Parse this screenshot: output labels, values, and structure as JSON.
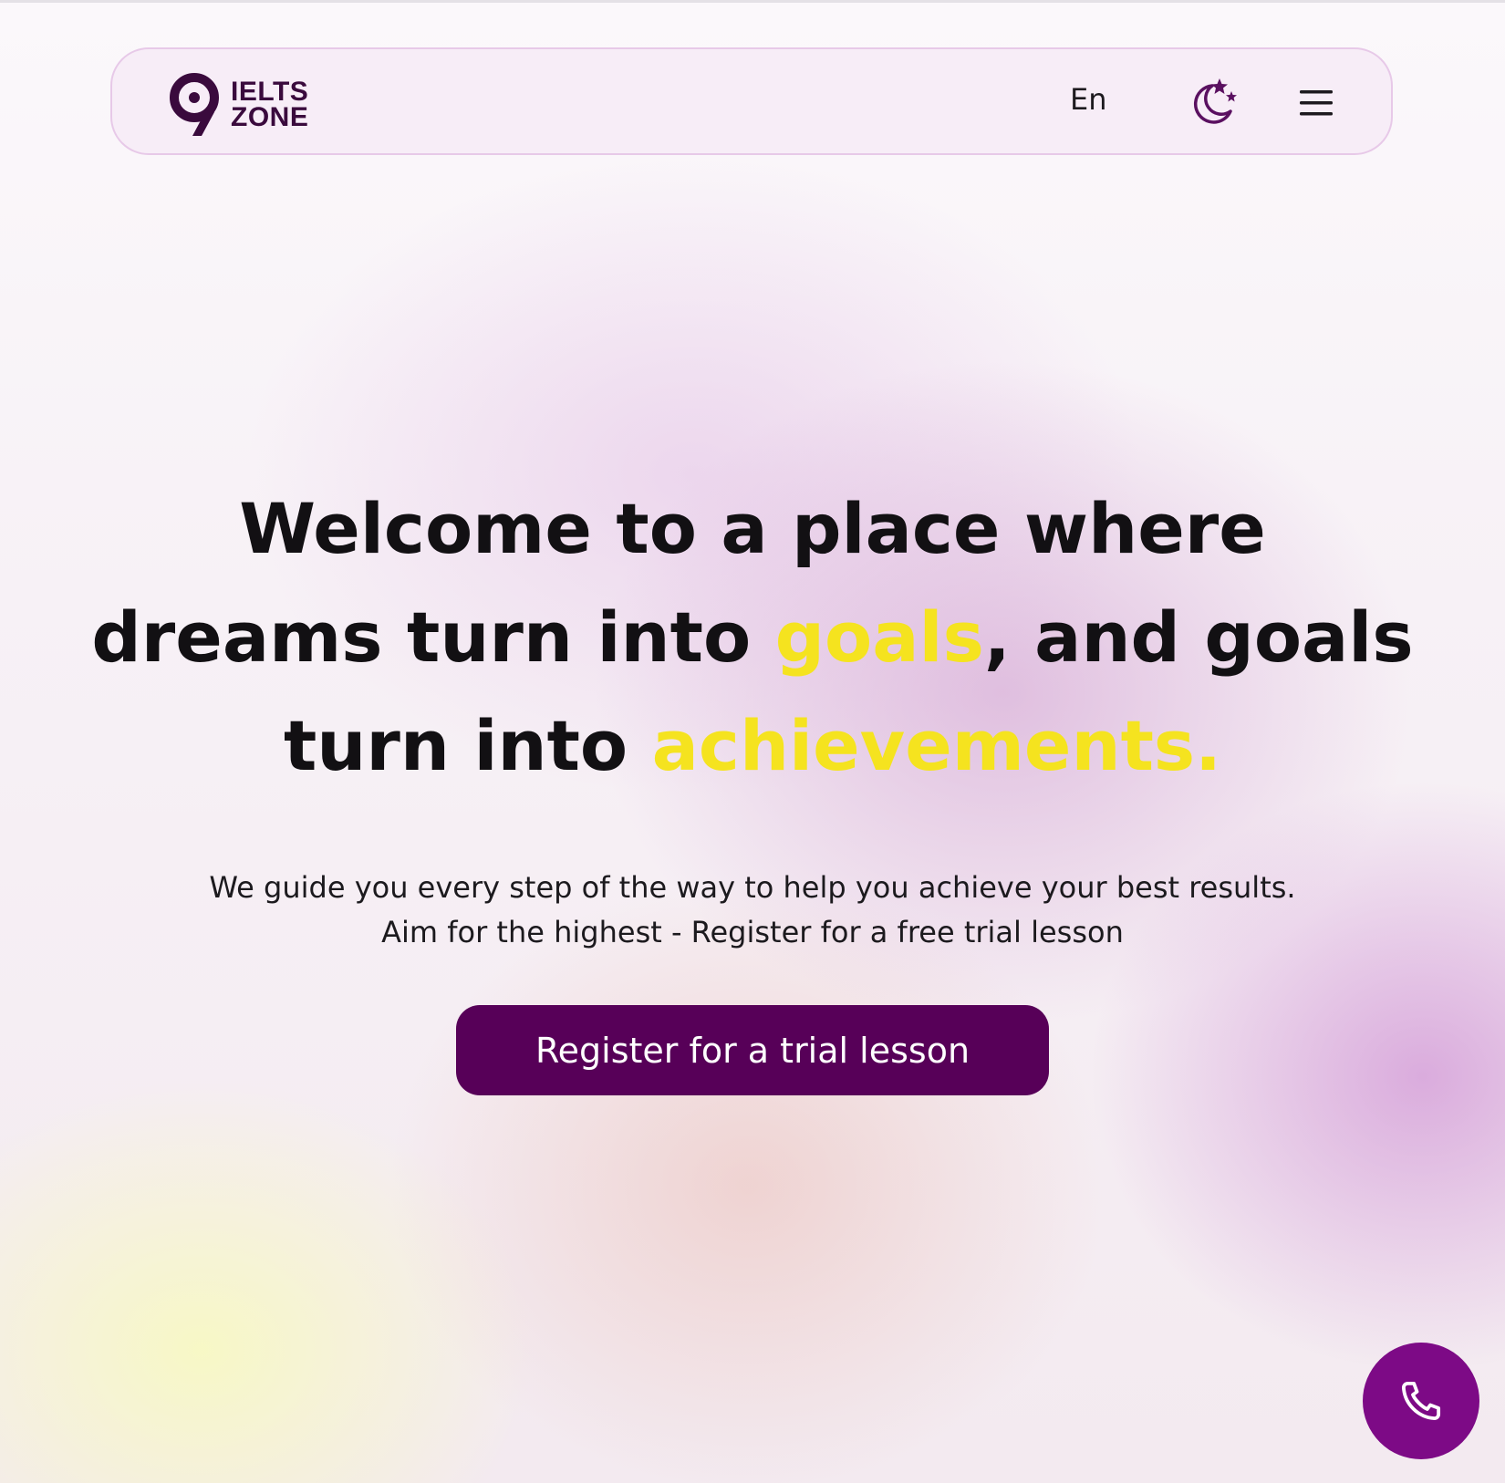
{
  "header": {
    "logo": {
      "line1": "IELTS",
      "line2": "ZONE",
      "icon": "ielts-zone-logo-icon"
    },
    "language": "En",
    "theme_icon": "moon-stars-icon",
    "menu_icon": "hamburger-menu-icon"
  },
  "hero": {
    "headline": {
      "line1": "Welcome to a place where",
      "line2_part1": "dreams turn into ",
      "line2_highlight": "goals",
      "line2_part2": ", and goals",
      "line3_part1": "turn into ",
      "line3_highlight": "achievements."
    },
    "subtitle": {
      "line1": "We guide you every step of the way to help you achieve your best results.",
      "line2": "Aim for the highest - Register for a free trial lesson"
    },
    "cta_label": "Register for a trial lesson"
  },
  "floating": {
    "phone_icon": "phone-icon"
  },
  "colors": {
    "brand": "#570058",
    "accent_purple": "#7d0a86",
    "highlight": "#f5e31f",
    "text": "#121013"
  }
}
